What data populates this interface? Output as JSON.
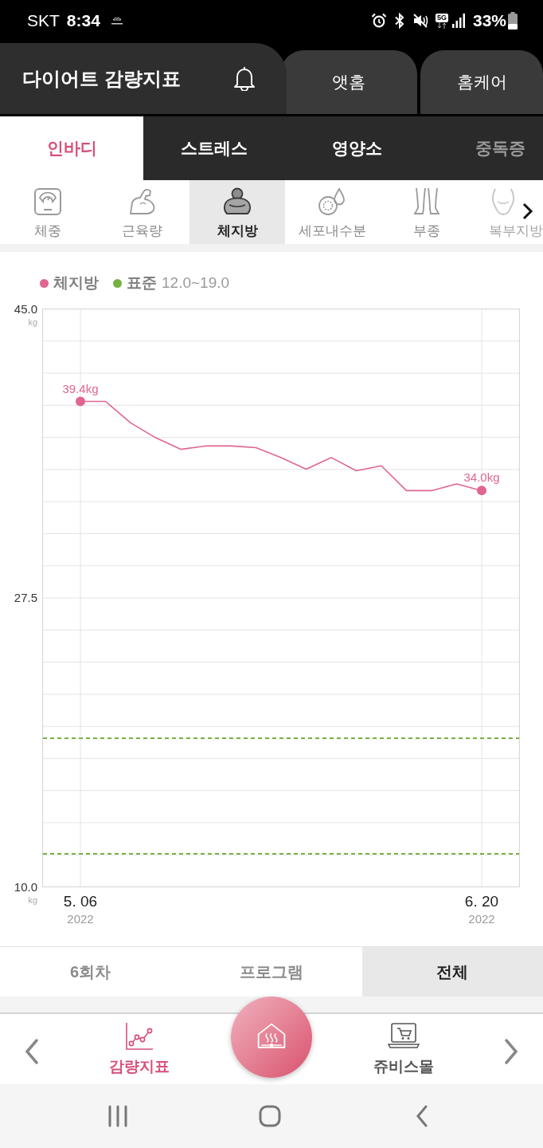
{
  "status_bar": {
    "carrier": "SKT",
    "time": "8:34",
    "network_type": "5G",
    "battery_text": "33%"
  },
  "header": {
    "tabs": [
      {
        "label": "다이어트 감량지표",
        "selected": true
      },
      {
        "label": "앳홈",
        "selected": false
      },
      {
        "label": "홈케어",
        "selected": false
      }
    ]
  },
  "category_tabs": [
    {
      "label": "인바디",
      "selected": true
    },
    {
      "label": "스트레스",
      "selected": false
    },
    {
      "label": "영양소",
      "selected": false
    },
    {
      "label": "중독증",
      "selected": false
    }
  ],
  "metric_tabs": [
    {
      "kind": "weight",
      "label": "체중",
      "selected": false
    },
    {
      "kind": "muscle",
      "label": "근육량",
      "selected": false
    },
    {
      "kind": "fat",
      "label": "체지방",
      "selected": true
    },
    {
      "kind": "water",
      "label": "세포내수분",
      "selected": false
    },
    {
      "kind": "edema",
      "label": "부종",
      "selected": false
    },
    {
      "kind": "abdomen",
      "label": "복부지방",
      "selected": false
    }
  ],
  "chart": {
    "chart_data": {
      "type": "line",
      "categories": [
        "5. 06",
        null,
        null,
        null,
        null,
        null,
        null,
        null,
        null,
        null,
        null,
        null,
        null,
        null,
        null,
        null,
        "6. 20"
      ],
      "ylim": [
        10,
        45
      ],
      "grid": true,
      "series": [
        {
          "name": "체지방",
          "color": "#e0668f",
          "values": [
            39.4,
            39.4,
            38.1,
            37.2,
            36.5,
            36.7,
            36.7,
            36.6,
            36.0,
            35.3,
            36.0,
            35.2,
            35.5,
            34.0,
            34.0,
            34.4,
            34.0
          ]
        }
      ],
      "yticks": [
        {
          "value": 45,
          "label": "45.0"
        },
        {
          "value": 27.5,
          "label": "27.5"
        },
        {
          "value": 10,
          "label": "10.0"
        }
      ],
      "ref_lines": [
        {
          "axis": "y",
          "value": 19,
          "color": "#78b041"
        },
        {
          "axis": "y",
          "value": 12,
          "color": "#78b041"
        }
      ],
      "annotations": [
        {
          "text": "39.4kg",
          "y": 39.4
        },
        {
          "text": "34.0kg",
          "y": 34.0
        }
      ]
    },
    "y_units": [
      "kg",
      "kg"
    ],
    "x_years": [
      "2022",
      "2022"
    ],
    "standard_legend": {
      "label": "표준",
      "range": "12.0~19.0",
      "color": "#78b041"
    }
  },
  "period_tabs": [
    {
      "label": "6회차",
      "selected": false
    },
    {
      "label": "프로그램",
      "selected": false
    },
    {
      "label": "전체",
      "selected": true
    }
  ],
  "bottom_nav": {
    "items": [
      {
        "kind": "chart",
        "label": "감량지표",
        "selected": true
      },
      {
        "kind": "mall",
        "label": "쥬비스몰",
        "selected": false
      }
    ]
  }
}
